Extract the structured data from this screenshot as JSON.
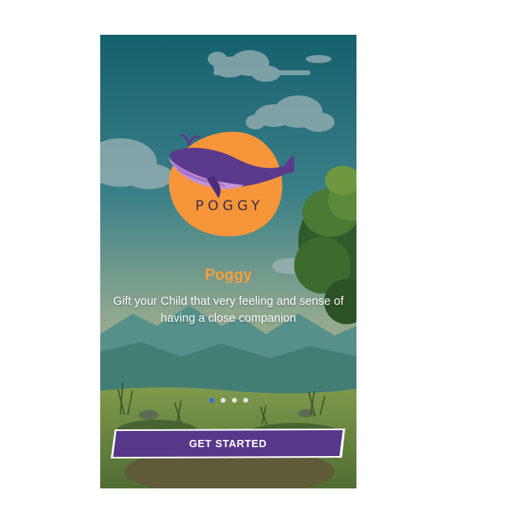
{
  "app": {
    "logo_text": "POGGY",
    "title": "Poggy",
    "subtitle": "Gift your Child that very feeling and sense of having a close companion"
  },
  "pager": {
    "count": 4,
    "active_index": 0
  },
  "cta": {
    "label": "GET STARTED"
  },
  "colors": {
    "accent_title": "#f4a03c",
    "sun_orange": "#f7953a",
    "whale_purple": "#5b3a8c",
    "button_purple": "#563789",
    "dot_active": "#2b6fe0"
  },
  "icons": {
    "logo": "whale-icon"
  }
}
